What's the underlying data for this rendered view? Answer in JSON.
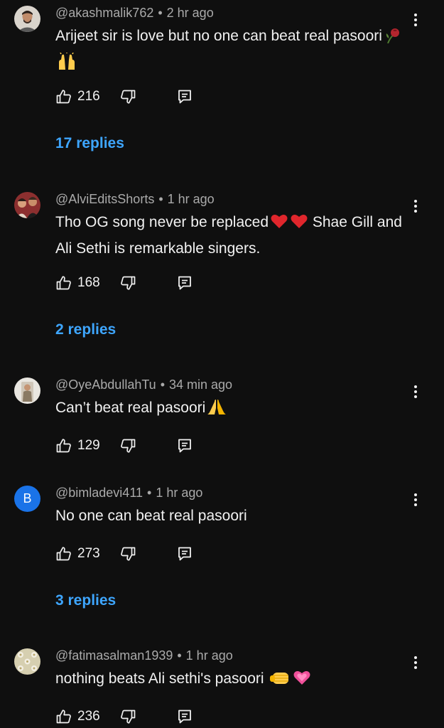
{
  "comments": [
    {
      "handle": "@akashmalik762",
      "time": "2 hr ago",
      "text": "Arijeet sir is love but no one can beat real pasoori",
      "emojis": [
        "wilted-rose-emoji",
        "raising-hands-emoji"
      ],
      "likes": "216",
      "replies": "17 replies"
    },
    {
      "handle": "@AlviEditsShorts",
      "time": "1 hr ago",
      "text_a": "Tho OG song never be replaced",
      "text_b": "Shae Gill and Ali Sethi is remarkable singers.",
      "emojis": [
        "red-heart-emoji",
        "red-heart-emoji"
      ],
      "likes": "168",
      "replies": "2 replies"
    },
    {
      "handle": "@OyeAbdullahTu",
      "time": "34 min ago",
      "text": "Can’t beat real pasoori",
      "emojis": [
        "folded-hands-emoji"
      ],
      "likes": "129"
    },
    {
      "handle": "@bimladevi411",
      "time": "1 hr ago",
      "avatar_letter": "B",
      "avatar_color": "#1a73e8",
      "text": "No one can beat real pasoori",
      "likes": "273",
      "replies": "3 replies"
    },
    {
      "handle": "@fatimasalman1939",
      "time": "1 hr ago",
      "text": "nothing beats Ali sethi's pasoori",
      "emojis": [
        "oncoming-fist-emoji",
        "growing-heart-emoji"
      ],
      "likes": "236"
    }
  ],
  "colors": {
    "background": "#0f0f0f",
    "link": "#3ea6ff",
    "meta_text": "#aaaaaa",
    "body_text": "#f1f1f1"
  },
  "icons": {
    "like": "thumb-up-icon",
    "dislike": "thumb-down-icon",
    "reply": "comment-reply-icon",
    "menu": "more-vertical-icon"
  }
}
